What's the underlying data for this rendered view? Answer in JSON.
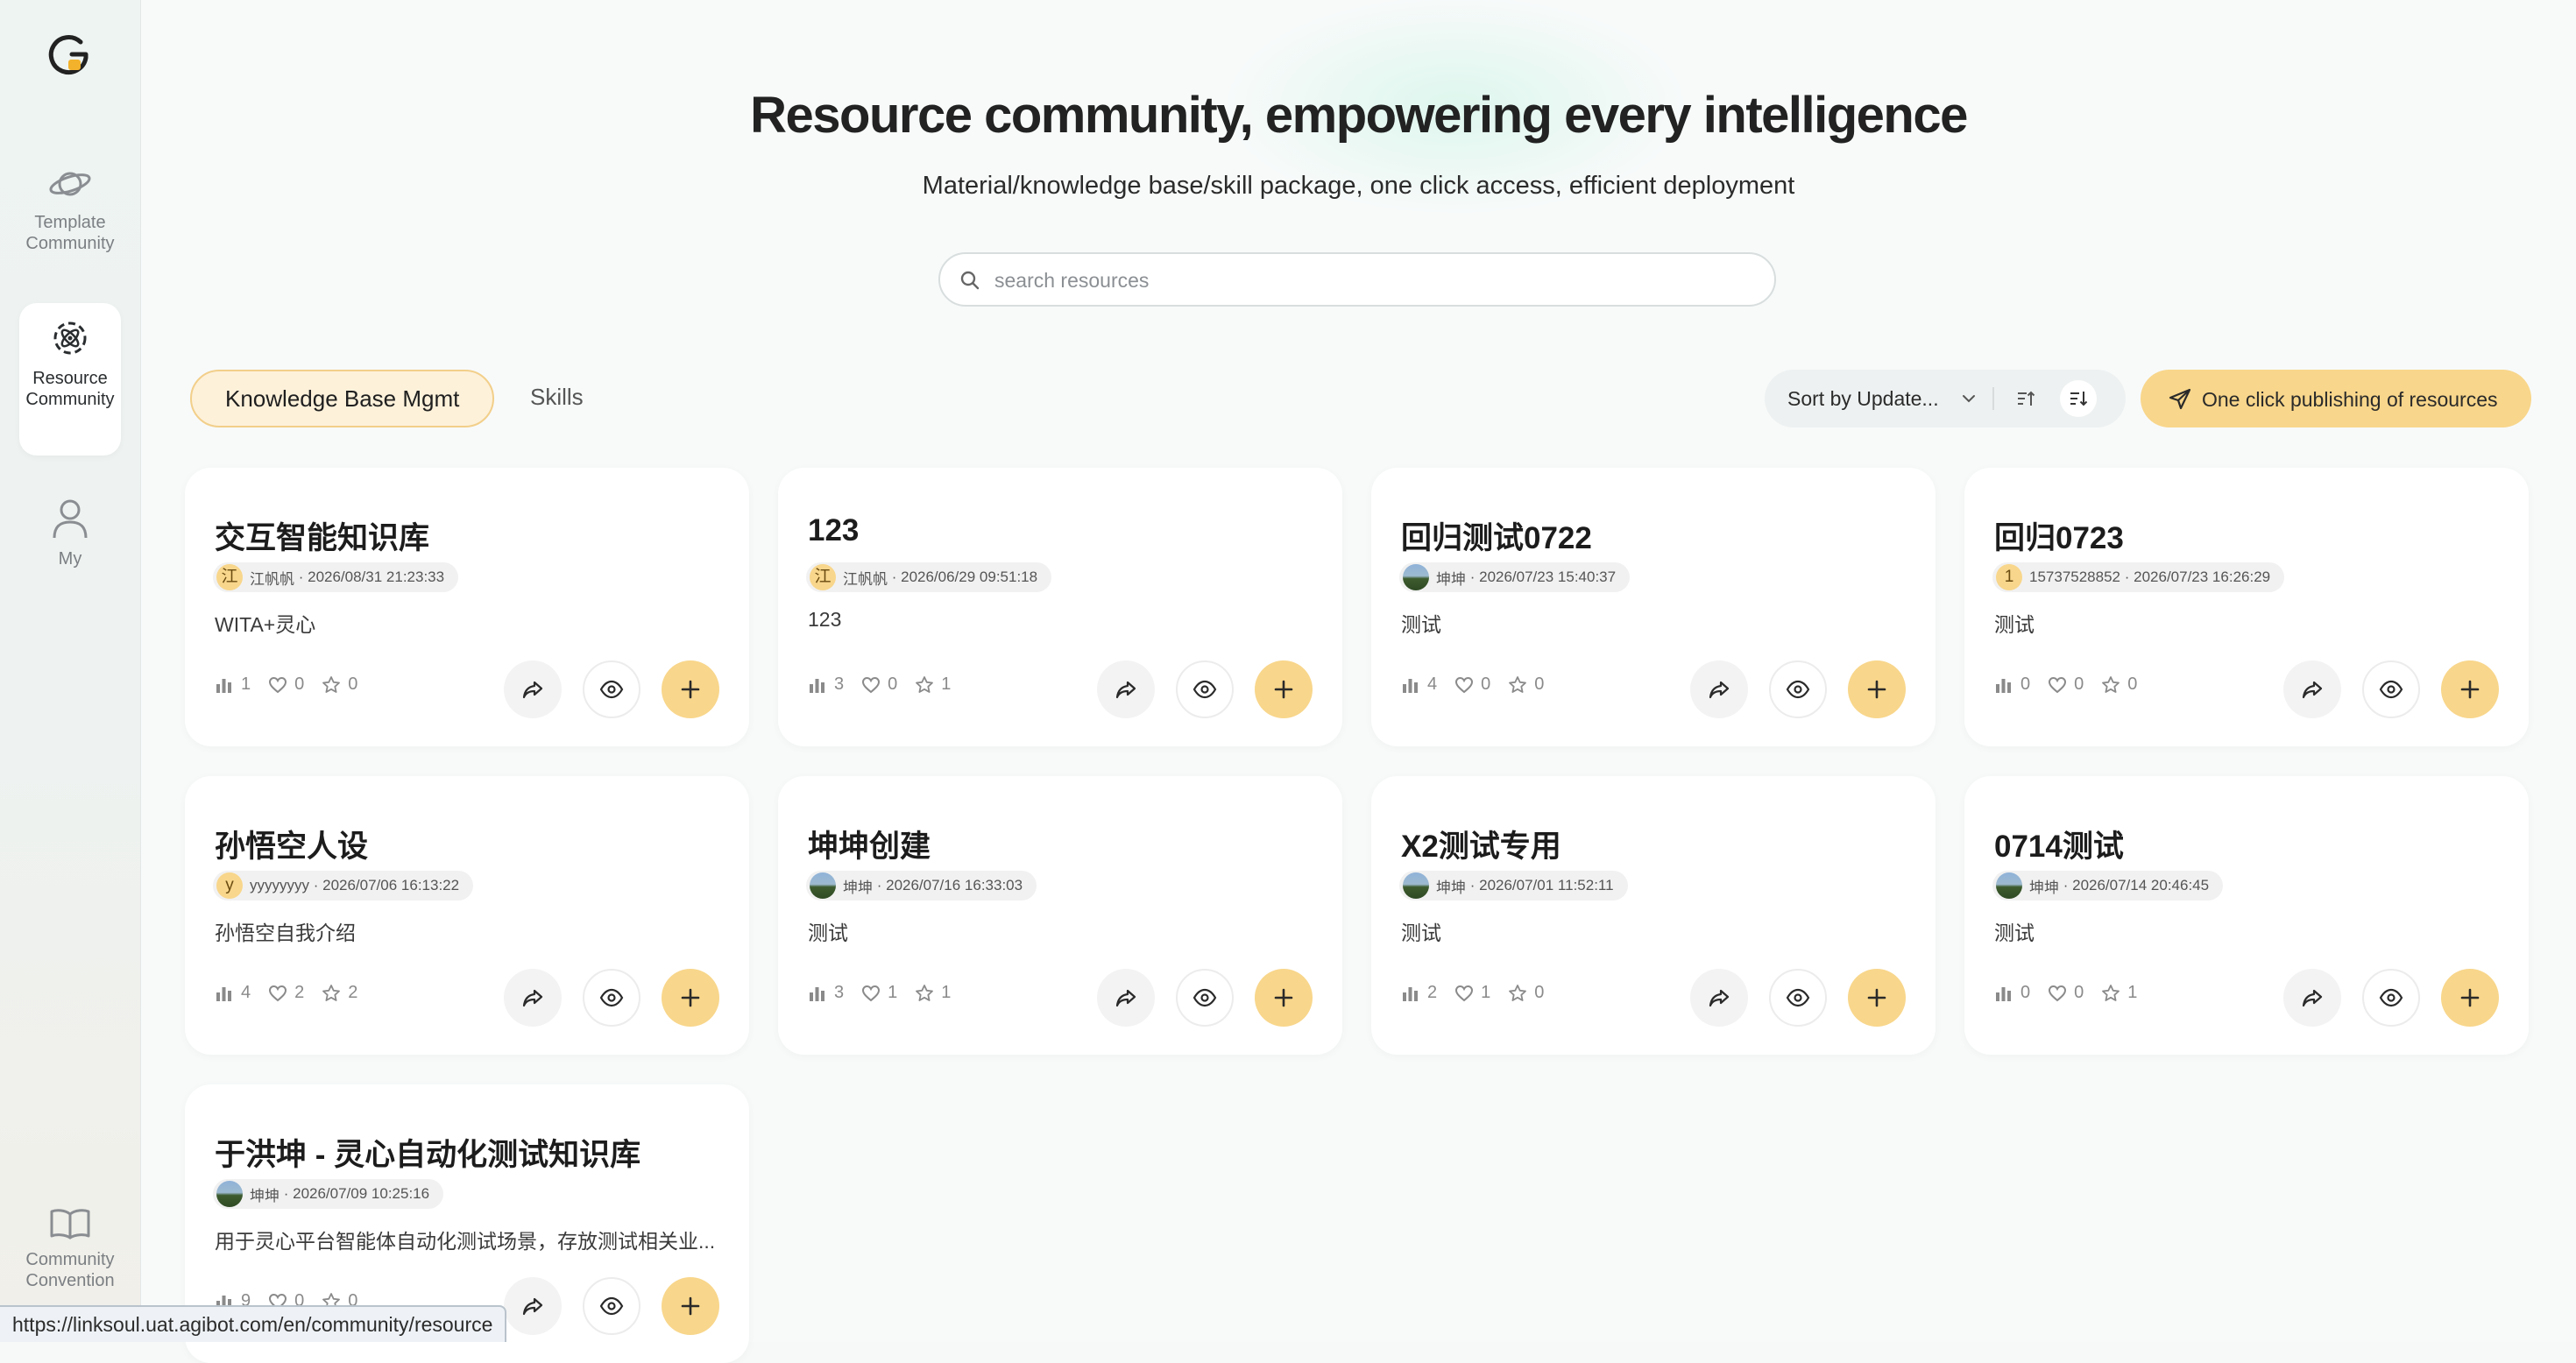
{
  "sidebar": {
    "items": [
      {
        "label_line1": "Template",
        "label_line2": "Community",
        "icon": "planet-icon"
      },
      {
        "label_line1": "Resource",
        "label_line2": "Community",
        "icon": "atom-gear-icon"
      },
      {
        "label_line1": "My",
        "label_line2": "",
        "icon": "user-icon"
      },
      {
        "label_line1": "Community",
        "label_line2": "Convention",
        "icon": "book-icon"
      }
    ]
  },
  "hero": {
    "title": "Resource community, empowering every intelligence",
    "subtitle": "Material/knowledge base/skill package, one click access, efficient deployment"
  },
  "search": {
    "placeholder": "search resources",
    "value": ""
  },
  "tabs": [
    {
      "label": "Knowledge Base Mgmt",
      "active": true
    },
    {
      "label": "Skills",
      "active": false
    }
  ],
  "sort": {
    "label": "Sort by Update..."
  },
  "publish": {
    "label": "One click publishing of resources"
  },
  "colors": {
    "accent": "#f8d68b",
    "accent_border": "#f2cf8a",
    "tab_active_bg": "#fdf1da"
  },
  "cards": [
    {
      "title": "交互智能知识库",
      "avatar_type": "letter",
      "avatar_text": "江",
      "author": "江帆帆",
      "date": "2026/08/31 21:23:33",
      "desc": "WITA+灵心",
      "views": "1",
      "likes": "0",
      "stars": "0"
    },
    {
      "title": "123",
      "avatar_type": "letter",
      "avatar_text": "江",
      "author": "江帆帆",
      "date": "2026/06/29 09:51:18",
      "desc": "123",
      "views": "3",
      "likes": "0",
      "stars": "1"
    },
    {
      "title": "回归测试0722",
      "avatar_type": "photo",
      "avatar_text": "",
      "author": "坤坤",
      "date": "2026/07/23 15:40:37",
      "desc": "测试",
      "views": "4",
      "likes": "0",
      "stars": "0"
    },
    {
      "title": "回归0723",
      "avatar_type": "letter",
      "avatar_text": "1",
      "author": "15737528852",
      "date": "2026/07/23 16:26:29",
      "desc": "测试",
      "views": "0",
      "likes": "0",
      "stars": "0"
    },
    {
      "title": "孙悟空人设",
      "avatar_type": "letter",
      "avatar_text": "y",
      "author": "yyyyyyyy",
      "date": "2026/07/06 16:13:22",
      "desc": "孙悟空自我介绍",
      "views": "4",
      "likes": "2",
      "stars": "2"
    },
    {
      "title": "坤坤创建",
      "avatar_type": "photo",
      "avatar_text": "",
      "author": "坤坤",
      "date": "2026/07/16 16:33:03",
      "desc": "测试",
      "views": "3",
      "likes": "1",
      "stars": "1"
    },
    {
      "title": "X2测试专用",
      "avatar_type": "photo",
      "avatar_text": "",
      "author": "坤坤",
      "date": "2026/07/01 11:52:11",
      "desc": "测试",
      "views": "2",
      "likes": "1",
      "stars": "0"
    },
    {
      "title": "0714测试",
      "avatar_type": "photo",
      "avatar_text": "",
      "author": "坤坤",
      "date": "2026/07/14 20:46:45",
      "desc": "测试",
      "views": "0",
      "likes": "0",
      "stars": "1"
    },
    {
      "title": "于洪坤 - 灵心自动化测试知识库",
      "avatar_type": "photo",
      "avatar_text": "",
      "author": "坤坤",
      "date": "2026/07/09 10:25:16",
      "desc": "用于灵心平台智能体自动化测试场景，存放测试相关业...",
      "views": "9",
      "likes": "0",
      "stars": "0"
    }
  ],
  "status_url": "https://linksoul.uat.agibot.com/en/community/resource"
}
